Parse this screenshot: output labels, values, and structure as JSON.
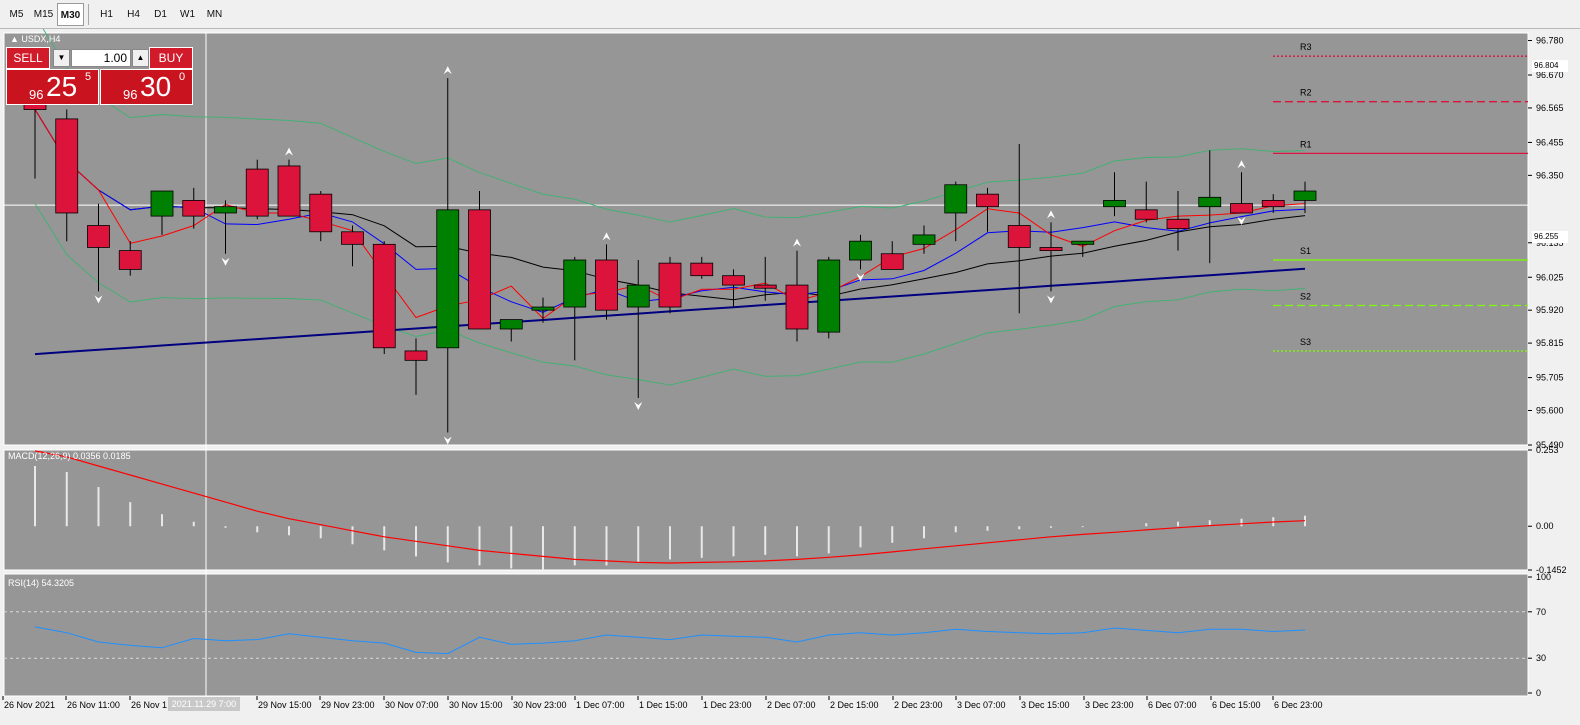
{
  "toolbar": {
    "timeframes": [
      "M5",
      "M15",
      "M30",
      "H1",
      "H4",
      "D1",
      "W1",
      "MN"
    ],
    "active": "M30"
  },
  "symbol_label": "USDX,H4",
  "trade_panel": {
    "sell_label": "SELL",
    "buy_label": "BUY",
    "lot": "1.00",
    "sell_price": {
      "prefix": "96",
      "big": "25",
      "sup": "5"
    },
    "buy_price": {
      "prefix": "96",
      "big": "30",
      "sup": "0"
    }
  },
  "price_axis": {
    "ticks": [
      "96.780",
      "96.670",
      "96.565",
      "96.455",
      "96.350",
      "96.135",
      "96.025",
      "95.920",
      "95.815",
      "95.705",
      "95.600",
      "95.490"
    ],
    "current_price": "96.255",
    "top_price": "96.804"
  },
  "pivots": {
    "labels": [
      "R3",
      "R2",
      "R1",
      "S1",
      "S2",
      "S3"
    ],
    "colors": {
      "R": "#dc143c",
      "S": "#7cfc00"
    }
  },
  "macd": {
    "label": "MACD(12,26,9) 0.0356 0.0185",
    "ticks": [
      "0.253",
      "0.00",
      "-0.1452"
    ]
  },
  "rsi": {
    "label": "RSI(14) 54.3205",
    "ticks": [
      "100",
      "70",
      "30",
      "0"
    ]
  },
  "time_axis": {
    "labels": [
      "26 Nov 2021",
      "26 Nov 11:00",
      "26 Nov 1",
      "29 Nov 15:00",
      "29 Nov 23:00",
      "30 Nov 07:00",
      "30 Nov 15:00",
      "30 Nov 23:00",
      "1 Dec 07:00",
      "1 Dec 15:00",
      "1 Dec 23:00",
      "2 Dec 07:00",
      "2 Dec 15:00",
      "2 Dec 23:00",
      "3 Dec 07:00",
      "3 Dec 15:00",
      "3 Dec 23:00",
      "6 Dec 07:00",
      "6 Dec 15:00",
      "6 Dec 23:00"
    ],
    "crosshair_date": "2021.11.29 7:00"
  },
  "colors": {
    "background": "#969696",
    "bull": "#008000",
    "bear": "#dc143c",
    "ma_fast": "#ff0000",
    "ma_blue": "#0000ff",
    "ma_black": "#000000",
    "ma_slow": "#000080",
    "bands": "#3cb371",
    "rsi": "#1e90ff",
    "macd_signal": "#ff0000"
  },
  "chart_data": [
    {
      "type": "candlestick",
      "title": "USDX,H4",
      "ylim": [
        95.49,
        96.804
      ],
      "x": [
        "26 Nov 2021",
        "26 Nov 07:00",
        "26 Nov 11:00",
        "26 Nov 15:00",
        "26 Nov 19:00",
        "29 Nov 03:00",
        "29 Nov 07:00",
        "29 Nov 11:00",
        "29 Nov 15:00",
        "29 Nov 19:00",
        "29 Nov 23:00",
        "30 Nov 03:00",
        "30 Nov 07:00",
        "30 Nov 11:00",
        "30 Nov 15:00",
        "30 Nov 19:00",
        "30 Nov 23:00",
        "1 Dec 03:00",
        "1 Dec 07:00",
        "1 Dec 11:00",
        "1 Dec 15:00",
        "1 Dec 19:00",
        "1 Dec 23:00",
        "2 Dec 03:00",
        "2 Dec 07:00",
        "2 Dec 11:00",
        "2 Dec 15:00",
        "2 Dec 19:00",
        "2 Dec 23:00",
        "3 Dec 03:00",
        "3 Dec 07:00",
        "3 Dec 11:00",
        "3 Dec 15:00",
        "3 Dec 19:00",
        "3 Dec 23:00",
        "6 Dec 03:00",
        "6 Dec 07:00",
        "6 Dec 11:00",
        "6 Dec 15:00",
        "6 Dec 19:00",
        "6 Dec 23:00"
      ],
      "open": [
        96.61,
        96.53,
        96.19,
        96.11,
        96.22,
        96.27,
        96.23,
        96.37,
        96.38,
        96.29,
        96.17,
        96.13,
        95.79,
        95.8,
        96.24,
        95.86,
        95.92,
        95.93,
        96.08,
        95.93,
        96.07,
        96.07,
        96.03,
        96.0,
        96.0,
        95.85,
        96.08,
        96.1,
        96.13,
        96.23,
        96.29,
        96.19,
        96.12,
        96.13,
        96.25,
        96.24,
        96.21,
        96.25,
        96.26,
        96.27,
        96.27
      ],
      "high": [
        96.64,
        96.56,
        96.26,
        96.14,
        96.3,
        96.31,
        96.27,
        96.4,
        96.4,
        96.3,
        96.19,
        96.14,
        95.83,
        96.66,
        96.3,
        95.89,
        95.96,
        96.09,
        96.13,
        96.08,
        96.09,
        96.09,
        96.05,
        96.09,
        96.11,
        96.09,
        96.16,
        96.14,
        96.19,
        96.33,
        96.31,
        96.45,
        96.2,
        96.14,
        96.36,
        96.33,
        96.3,
        96.43,
        96.36,
        96.29,
        96.33
      ],
      "low": [
        96.34,
        96.14,
        95.98,
        96.03,
        96.16,
        96.18,
        96.1,
        96.21,
        96.22,
        96.14,
        96.06,
        95.78,
        95.65,
        95.53,
        95.86,
        95.82,
        95.88,
        95.76,
        95.89,
        95.64,
        95.91,
        96.02,
        95.93,
        95.95,
        95.82,
        95.83,
        96.05,
        96.08,
        96.1,
        96.14,
        96.17,
        95.91,
        95.98,
        96.09,
        96.22,
        96.2,
        96.11,
        96.07,
        96.23,
        96.23,
        96.23
      ],
      "close": [
        96.56,
        96.23,
        96.12,
        96.05,
        96.3,
        96.22,
        96.25,
        96.22,
        96.22,
        96.17,
        96.13,
        95.8,
        95.76,
        96.24,
        95.86,
        95.89,
        95.93,
        96.08,
        95.92,
        96.0,
        95.93,
        96.03,
        96.0,
        95.99,
        95.86,
        96.08,
        96.14,
        96.05,
        96.16,
        96.32,
        96.25,
        96.12,
        96.11,
        96.14,
        96.27,
        96.21,
        96.18,
        96.28,
        96.23,
        96.25,
        96.3
      ]
    },
    {
      "type": "bar",
      "title": "MACD(12,26,9) 0.0356 0.0185",
      "ylim": [
        -0.1452,
        0.253
      ],
      "values": [
        0.2,
        0.18,
        0.13,
        0.08,
        0.04,
        0.015,
        -0.005,
        -0.02,
        -0.03,
        -0.04,
        -0.06,
        -0.08,
        -0.1,
        -0.12,
        -0.13,
        -0.14,
        -0.145,
        -0.13,
        -0.13,
        -0.12,
        -0.11,
        -0.105,
        -0.1,
        -0.095,
        -0.1,
        -0.09,
        -0.07,
        -0.055,
        -0.04,
        -0.02,
        -0.015,
        -0.01,
        -0.005,
        -0.003,
        0.0,
        0.01,
        0.015,
        0.02,
        0.025,
        0.03,
        0.035
      ],
      "signal": [
        0.25,
        0.23,
        0.2,
        0.17,
        0.14,
        0.11,
        0.08,
        0.05,
        0.025,
        0.005,
        -0.015,
        -0.035,
        -0.05,
        -0.065,
        -0.08,
        -0.09,
        -0.1,
        -0.11,
        -0.115,
        -0.12,
        -0.122,
        -0.12,
        -0.118,
        -0.115,
        -0.11,
        -0.103,
        -0.095,
        -0.085,
        -0.075,
        -0.065,
        -0.055,
        -0.045,
        -0.035,
        -0.027,
        -0.02,
        -0.012,
        -0.005,
        0.002,
        0.008,
        0.014,
        0.0185
      ]
    },
    {
      "type": "line",
      "title": "RSI(14) 54.3205",
      "ylim": [
        0,
        100
      ],
      "values": [
        57,
        52,
        44,
        41,
        39,
        47,
        45,
        46,
        51,
        48,
        45,
        43,
        35,
        34,
        48,
        42,
        43,
        45,
        50,
        48,
        46,
        50,
        49,
        48,
        44,
        50,
        52,
        50,
        52,
        55,
        53,
        52,
        51,
        52,
        56,
        54,
        52,
        55,
        55,
        53,
        54.32
      ]
    }
  ]
}
